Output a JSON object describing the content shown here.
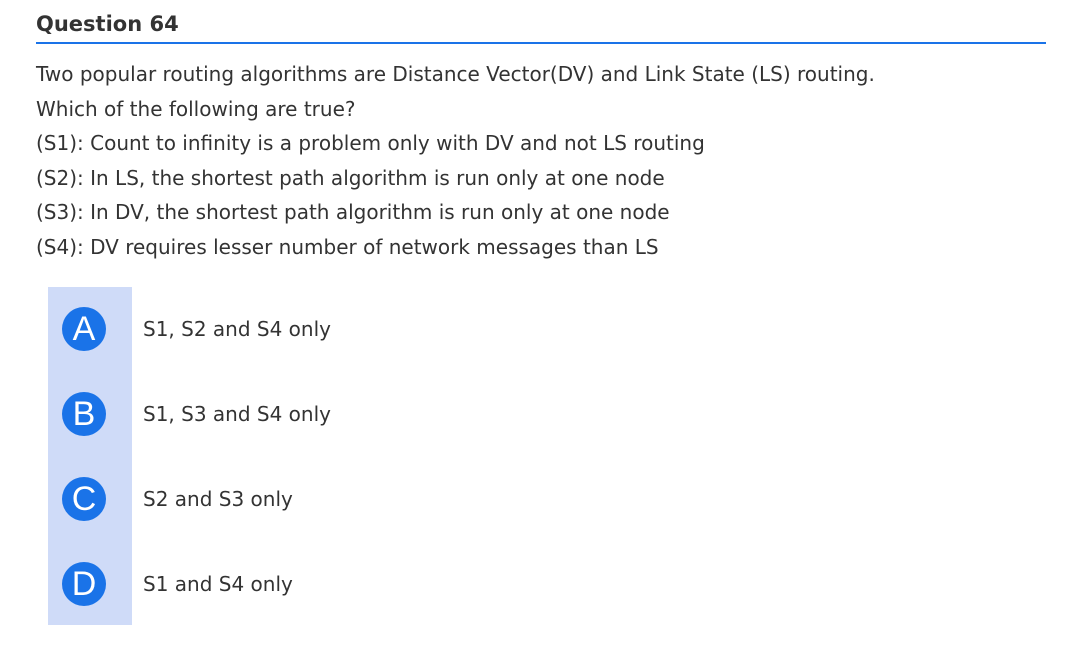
{
  "question": {
    "title": "Question 64",
    "lines": [
      "Two popular routing algorithms are Distance Vector(DV) and Link State (LS) routing.",
      "Which of the following are true?",
      "(S1): Count to infinity is a problem only with DV and not LS routing",
      "(S2): In LS, the shortest path algorithm is run only at one node",
      "(S3): In DV, the shortest path algorithm is run only at one node",
      "(S4): DV requires lesser number of network messages than LS"
    ]
  },
  "options": [
    {
      "letter": "A",
      "text": "S1, S2 and S4 only"
    },
    {
      "letter": "B",
      "text": "S1, S3 and S4 only"
    },
    {
      "letter": "C",
      "text": "S2 and S3 only"
    },
    {
      "letter": "D",
      "text": "S1 and S4 only"
    }
  ],
  "colors": {
    "accent": "#1a73e8",
    "option_strip": "#cfdbf8",
    "text": "#333333"
  }
}
